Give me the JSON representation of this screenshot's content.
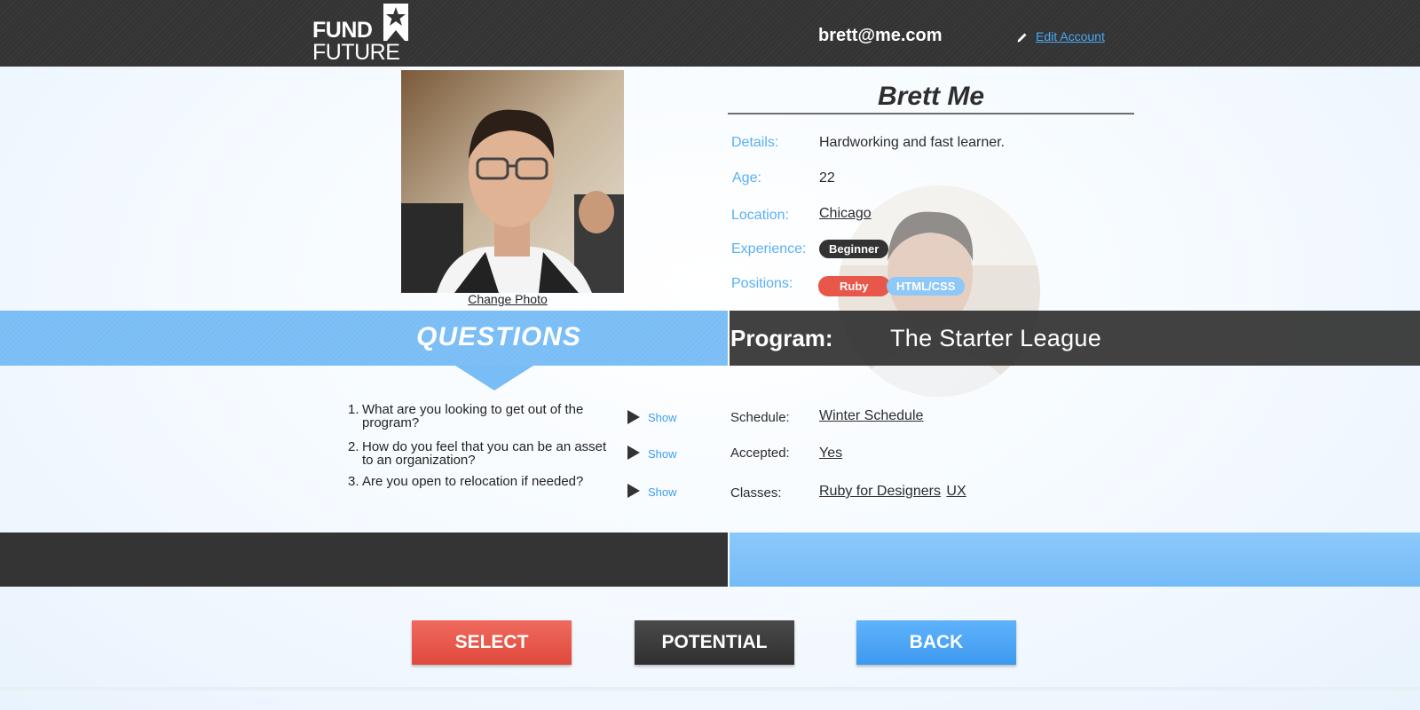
{
  "header": {
    "logo": {
      "line1": "FUND",
      "line2": "FUTURE"
    },
    "user_email": "brett@me.com",
    "edit_account_label": "Edit Account"
  },
  "profile": {
    "change_photo_label": "Change Photo",
    "name": "Brett Me",
    "details_label": "Details:",
    "details_value": "Hardworking and fast learner.",
    "age_label": "Age:",
    "age_value": "22",
    "location_label": "Location:",
    "location_value": "Chicago",
    "experience_label": "Experience:",
    "experience_value": "Beginner",
    "positions_label": "Positions:",
    "positions": [
      "Ruby",
      "HTML/CSS"
    ]
  },
  "questions": {
    "title": "QUESTIONS",
    "items": [
      {
        "num": "1.",
        "line1": "What are you looking to get out of the",
        "line2": "program?",
        "show": "Show"
      },
      {
        "num": "2.",
        "line1": "How do you feel that you can be an asset",
        "line2": "to an organization?",
        "show": "Show"
      },
      {
        "num": "3.",
        "line1": "Are you open to relocation if needed?",
        "line2": "",
        "show": "Show"
      }
    ]
  },
  "program": {
    "label": "Program:",
    "value": "The Starter League",
    "schedule_label": "Schedule:",
    "schedule_value": "Winter Schedule",
    "accepted_label": "Accepted:",
    "accepted_value": "Yes",
    "classes_label": "Classes:",
    "classes": [
      "Ruby for Designers",
      "UX"
    ]
  },
  "actions": {
    "select_label": "SELECT",
    "potential_label": "POTENTIAL",
    "back_label": "BACK"
  },
  "colors": {
    "topbar": "#333333",
    "accent_blue": "#5ab0f3",
    "band_blue": "#79bdf6",
    "select_red": "#e8584a",
    "back_blue": "#4aa6f4"
  }
}
